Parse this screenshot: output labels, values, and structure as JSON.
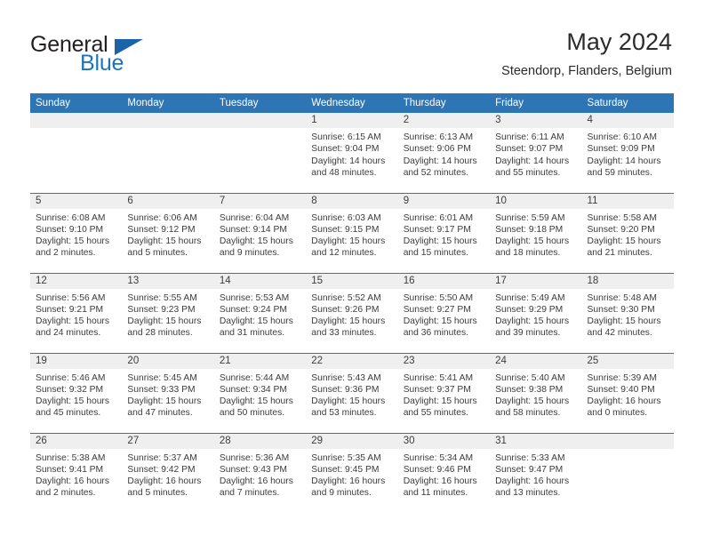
{
  "logo": {
    "general_text": "General",
    "blue_text": "Blue",
    "triangle_color": "#1c64a8",
    "blue_color": "#1c75bc"
  },
  "header": {
    "title": "May 2024",
    "subtitle": "Steendorp, Flanders, Belgium"
  },
  "theme": {
    "header_bar_color": "#2e75b6",
    "daynum_bar_color": "#efefef",
    "text_color": "#3c3c3c"
  },
  "weekdays": [
    "Sunday",
    "Monday",
    "Tuesday",
    "Wednesday",
    "Thursday",
    "Friday",
    "Saturday"
  ],
  "weeks": [
    [
      {
        "day": "",
        "lines": []
      },
      {
        "day": "",
        "lines": []
      },
      {
        "day": "",
        "lines": []
      },
      {
        "day": "1",
        "lines": [
          "Sunrise: 6:15 AM",
          "Sunset: 9:04 PM",
          "Daylight: 14 hours",
          "and 48 minutes."
        ]
      },
      {
        "day": "2",
        "lines": [
          "Sunrise: 6:13 AM",
          "Sunset: 9:06 PM",
          "Daylight: 14 hours",
          "and 52 minutes."
        ]
      },
      {
        "day": "3",
        "lines": [
          "Sunrise: 6:11 AM",
          "Sunset: 9:07 PM",
          "Daylight: 14 hours",
          "and 55 minutes."
        ]
      },
      {
        "day": "4",
        "lines": [
          "Sunrise: 6:10 AM",
          "Sunset: 9:09 PM",
          "Daylight: 14 hours",
          "and 59 minutes."
        ]
      }
    ],
    [
      {
        "day": "5",
        "lines": [
          "Sunrise: 6:08 AM",
          "Sunset: 9:10 PM",
          "Daylight: 15 hours",
          "and 2 minutes."
        ]
      },
      {
        "day": "6",
        "lines": [
          "Sunrise: 6:06 AM",
          "Sunset: 9:12 PM",
          "Daylight: 15 hours",
          "and 5 minutes."
        ]
      },
      {
        "day": "7",
        "lines": [
          "Sunrise: 6:04 AM",
          "Sunset: 9:14 PM",
          "Daylight: 15 hours",
          "and 9 minutes."
        ]
      },
      {
        "day": "8",
        "lines": [
          "Sunrise: 6:03 AM",
          "Sunset: 9:15 PM",
          "Daylight: 15 hours",
          "and 12 minutes."
        ]
      },
      {
        "day": "9",
        "lines": [
          "Sunrise: 6:01 AM",
          "Sunset: 9:17 PM",
          "Daylight: 15 hours",
          "and 15 minutes."
        ]
      },
      {
        "day": "10",
        "lines": [
          "Sunrise: 5:59 AM",
          "Sunset: 9:18 PM",
          "Daylight: 15 hours",
          "and 18 minutes."
        ]
      },
      {
        "day": "11",
        "lines": [
          "Sunrise: 5:58 AM",
          "Sunset: 9:20 PM",
          "Daylight: 15 hours",
          "and 21 minutes."
        ]
      }
    ],
    [
      {
        "day": "12",
        "lines": [
          "Sunrise: 5:56 AM",
          "Sunset: 9:21 PM",
          "Daylight: 15 hours",
          "and 24 minutes."
        ]
      },
      {
        "day": "13",
        "lines": [
          "Sunrise: 5:55 AM",
          "Sunset: 9:23 PM",
          "Daylight: 15 hours",
          "and 28 minutes."
        ]
      },
      {
        "day": "14",
        "lines": [
          "Sunrise: 5:53 AM",
          "Sunset: 9:24 PM",
          "Daylight: 15 hours",
          "and 31 minutes."
        ]
      },
      {
        "day": "15",
        "lines": [
          "Sunrise: 5:52 AM",
          "Sunset: 9:26 PM",
          "Daylight: 15 hours",
          "and 33 minutes."
        ]
      },
      {
        "day": "16",
        "lines": [
          "Sunrise: 5:50 AM",
          "Sunset: 9:27 PM",
          "Daylight: 15 hours",
          "and 36 minutes."
        ]
      },
      {
        "day": "17",
        "lines": [
          "Sunrise: 5:49 AM",
          "Sunset: 9:29 PM",
          "Daylight: 15 hours",
          "and 39 minutes."
        ]
      },
      {
        "day": "18",
        "lines": [
          "Sunrise: 5:48 AM",
          "Sunset: 9:30 PM",
          "Daylight: 15 hours",
          "and 42 minutes."
        ]
      }
    ],
    [
      {
        "day": "19",
        "lines": [
          "Sunrise: 5:46 AM",
          "Sunset: 9:32 PM",
          "Daylight: 15 hours",
          "and 45 minutes."
        ]
      },
      {
        "day": "20",
        "lines": [
          "Sunrise: 5:45 AM",
          "Sunset: 9:33 PM",
          "Daylight: 15 hours",
          "and 47 minutes."
        ]
      },
      {
        "day": "21",
        "lines": [
          "Sunrise: 5:44 AM",
          "Sunset: 9:34 PM",
          "Daylight: 15 hours",
          "and 50 minutes."
        ]
      },
      {
        "day": "22",
        "lines": [
          "Sunrise: 5:43 AM",
          "Sunset: 9:36 PM",
          "Daylight: 15 hours",
          "and 53 minutes."
        ]
      },
      {
        "day": "23",
        "lines": [
          "Sunrise: 5:41 AM",
          "Sunset: 9:37 PM",
          "Daylight: 15 hours",
          "and 55 minutes."
        ]
      },
      {
        "day": "24",
        "lines": [
          "Sunrise: 5:40 AM",
          "Sunset: 9:38 PM",
          "Daylight: 15 hours",
          "and 58 minutes."
        ]
      },
      {
        "day": "25",
        "lines": [
          "Sunrise: 5:39 AM",
          "Sunset: 9:40 PM",
          "Daylight: 16 hours",
          "and 0 minutes."
        ]
      }
    ],
    [
      {
        "day": "26",
        "lines": [
          "Sunrise: 5:38 AM",
          "Sunset: 9:41 PM",
          "Daylight: 16 hours",
          "and 2 minutes."
        ]
      },
      {
        "day": "27",
        "lines": [
          "Sunrise: 5:37 AM",
          "Sunset: 9:42 PM",
          "Daylight: 16 hours",
          "and 5 minutes."
        ]
      },
      {
        "day": "28",
        "lines": [
          "Sunrise: 5:36 AM",
          "Sunset: 9:43 PM",
          "Daylight: 16 hours",
          "and 7 minutes."
        ]
      },
      {
        "day": "29",
        "lines": [
          "Sunrise: 5:35 AM",
          "Sunset: 9:45 PM",
          "Daylight: 16 hours",
          "and 9 minutes."
        ]
      },
      {
        "day": "30",
        "lines": [
          "Sunrise: 5:34 AM",
          "Sunset: 9:46 PM",
          "Daylight: 16 hours",
          "and 11 minutes."
        ]
      },
      {
        "day": "31",
        "lines": [
          "Sunrise: 5:33 AM",
          "Sunset: 9:47 PM",
          "Daylight: 16 hours",
          "and 13 minutes."
        ]
      },
      {
        "day": "",
        "lines": []
      }
    ]
  ]
}
